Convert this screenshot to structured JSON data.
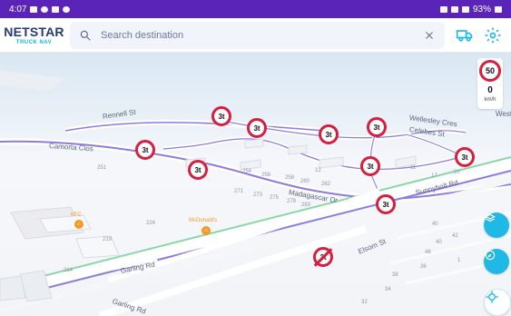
{
  "status": {
    "time": "4:07",
    "battery": "93%"
  },
  "header": {
    "brand_title": "NETSTAR",
    "brand_subtitle": "TRUCK NAV",
    "search_placeholder": "Search destination"
  },
  "map": {
    "speed_limit": "50",
    "current_speed": "0",
    "speed_unit": "km/h",
    "weight_badge": "3t",
    "streets": [
      "Rennell St",
      "Camorta Clos",
      "Wellesley Cres",
      "Celebes St",
      "Madagascar Dr",
      "Sunnyholt Rd",
      "Garling Rd",
      "Garling Rd",
      "Elsom St",
      "West"
    ],
    "house_numbers": [
      "251",
      "254",
      "256",
      "258",
      "260",
      "262",
      "271",
      "273",
      "275",
      "279",
      "283",
      "12",
      "11",
      "17",
      "20",
      "224",
      "219",
      "214",
      "48",
      "40",
      "42",
      "36",
      "34",
      "32",
      "38",
      "40",
      "1"
    ],
    "pois": [
      {
        "label": "KFC"
      },
      {
        "label": "McDonald's"
      }
    ],
    "colors": {
      "accent": "#20b8e5",
      "limit": "#d61f3e",
      "route": "#8d7be0",
      "status": "#5a24b8"
    }
  }
}
